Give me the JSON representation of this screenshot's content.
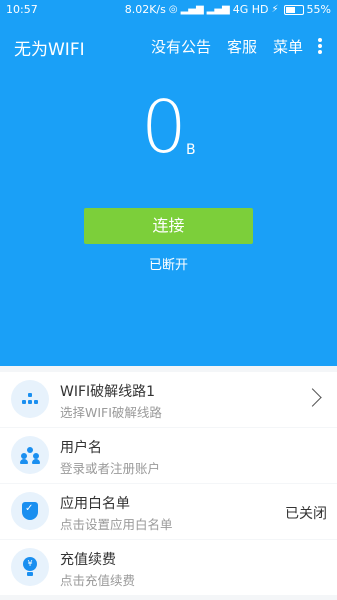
{
  "statusbar": {
    "time": "10:57",
    "speed": "8.02K/s",
    "network": "4G HD",
    "battery": "55%"
  },
  "appbar": {
    "title": "无为WIFI",
    "menu": [
      "没有公告",
      "客服",
      "菜单"
    ]
  },
  "traffic": {
    "value": "0",
    "unit": "B"
  },
  "connect": {
    "label": "连接",
    "status": "已断开"
  },
  "list": [
    {
      "title": "WIFI破解线路1",
      "subtitle": "选择WIFI破解线路",
      "value": ""
    },
    {
      "title": "用户名",
      "subtitle": "登录或者注册账户",
      "value": ""
    },
    {
      "title": "应用白名单",
      "subtitle": "点击设置应用白名单",
      "value": "已关闭"
    },
    {
      "title": "充值续费",
      "subtitle": "点击充值续费",
      "value": ""
    }
  ],
  "icons": [
    "wifi-dots-icon",
    "users-icon",
    "shield-icon",
    "bulb-yen-icon"
  ],
  "colors": {
    "primary": "#1aa0f7",
    "connect_button": "#7ccf3a"
  }
}
